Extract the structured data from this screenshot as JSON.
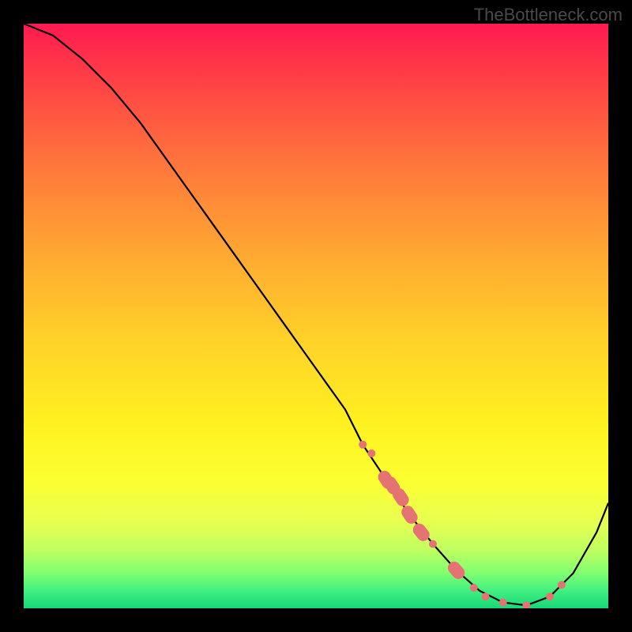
{
  "watermark": "TheBottleneck.com",
  "chart_data": {
    "type": "line",
    "title": "",
    "xlabel": "",
    "ylabel": "",
    "xlim": [
      0,
      100
    ],
    "ylim": [
      0,
      100
    ],
    "x": [
      0,
      5,
      10,
      15,
      20,
      25,
      30,
      35,
      40,
      45,
      50,
      55,
      58,
      62,
      66,
      70,
      74,
      78,
      82,
      86,
      90,
      94,
      98,
      100
    ],
    "values": [
      100,
      98,
      94,
      89,
      83,
      76,
      69,
      62,
      55,
      48,
      41,
      34,
      28,
      22,
      16,
      11,
      6.5,
      3,
      1,
      0.5,
      2,
      6,
      13,
      18
    ],
    "markers": {
      "x": [
        58,
        59.5,
        62,
        63,
        64.5,
        66,
        68,
        70,
        74,
        77,
        79,
        82,
        86,
        90,
        92
      ],
      "values": [
        28,
        26.5,
        22,
        21,
        19,
        16,
        13,
        11,
        6.5,
        3.5,
        2,
        1,
        0.5,
        2,
        4
      ],
      "sizes": [
        5,
        5,
        8,
        8,
        8,
        8,
        8,
        5,
        8,
        5,
        5,
        5,
        5,
        5,
        5
      ]
    },
    "background_gradient": {
      "top": "#ff1a50",
      "mid": "#ffd428",
      "bottom": "#18d878"
    }
  }
}
